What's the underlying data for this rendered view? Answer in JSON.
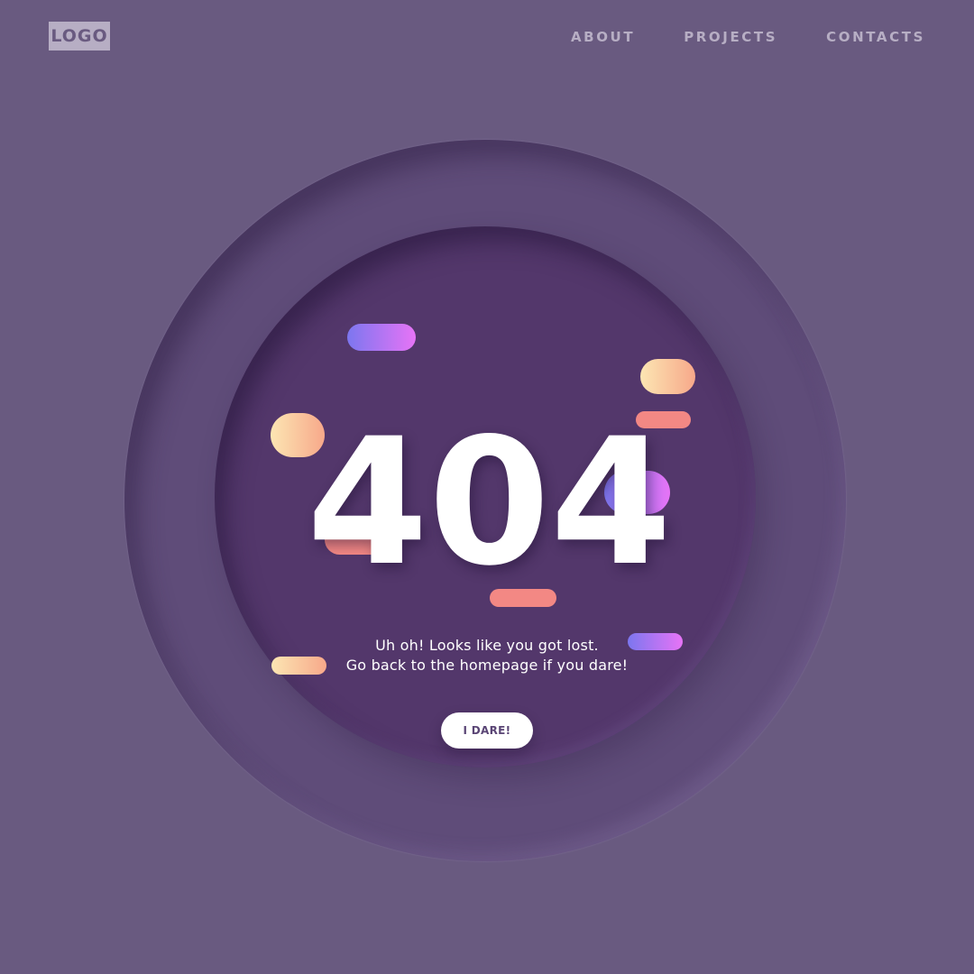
{
  "header": {
    "logo_label": "LOGO",
    "nav": [
      {
        "label": "ABOUT"
      },
      {
        "label": "PROJECTS"
      },
      {
        "label": "CONTACTS"
      }
    ]
  },
  "error": {
    "code": "404",
    "message_line_1": "Uh oh! Looks like you got lost.",
    "message_line_2": "Go back to the homepage if you dare!",
    "button_label": "I DARE!"
  },
  "colors": {
    "background": "#695a80",
    "outer_circle": "#5f4c79",
    "inner_circle": "#53376b",
    "purple_gradient_start": "#7c76ef",
    "purple_gradient_end": "#e774f6",
    "peach_gradient_start": "#fce6b3",
    "peach_gradient_end": "#f7a88a",
    "salmon": "#f38884",
    "text": "#ffffff"
  }
}
